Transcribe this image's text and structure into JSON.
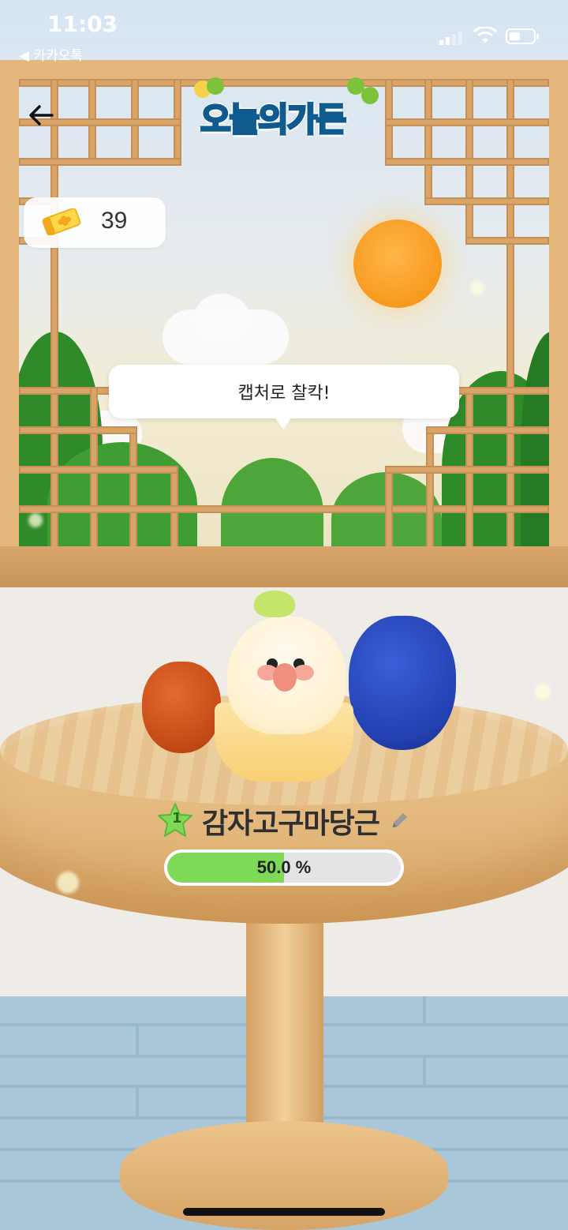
{
  "status_bar": {
    "time": "11:03",
    "back_app_label": "◀ 카카오톡",
    "icons": [
      "cellular-signal-icon",
      "wifi-icon",
      "battery-icon"
    ]
  },
  "header": {
    "back_icon": "arrow-left-icon",
    "logo_text": "오늘의가든"
  },
  "tickets": {
    "icon": "clover-ticket-icon",
    "count": "39"
  },
  "tooltip": {
    "text": "캡처로 찰칵!"
  },
  "plant": {
    "level": "1",
    "name": "감자고구마당근",
    "edit_icon": "pencil-icon"
  },
  "growth": {
    "percent_label": "50.0 %",
    "fraction": 0.5,
    "fill_color": "#7ed957"
  },
  "colors": {
    "frame_wood": "#e6b77c",
    "sun": "#f79a1e",
    "floor": "#a9c7d9"
  }
}
